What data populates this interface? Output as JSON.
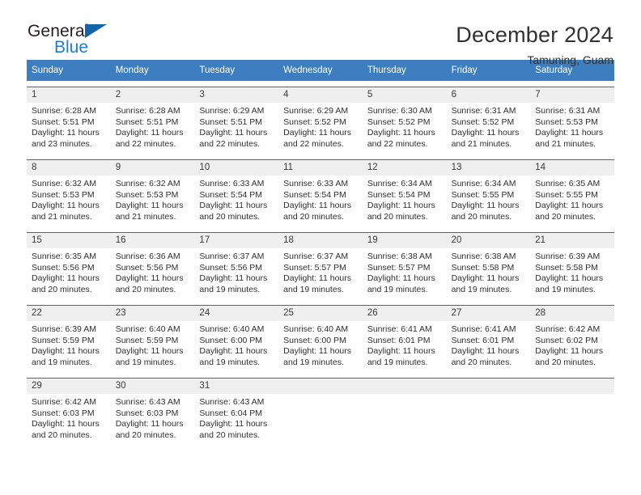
{
  "brand": {
    "name_top": "General",
    "name_bottom": "Blue",
    "triangle_color": "#1464aa",
    "blue_text_color": "#1b7fd4"
  },
  "header": {
    "title": "December 2024",
    "subtitle": "Tamuning, Guam"
  },
  "theme": {
    "header_row_bg": "#3c7ebf",
    "day_number_bg": "#efefef",
    "week_border": "#2f6ea8",
    "text": "#2e2e2e"
  },
  "weekdays": [
    "Sunday",
    "Monday",
    "Tuesday",
    "Wednesday",
    "Thursday",
    "Friday",
    "Saturday"
  ],
  "weeks": [
    [
      {
        "day": "1",
        "sunrise": "Sunrise: 6:28 AM",
        "sunset": "Sunset: 5:51 PM",
        "daylight1": "Daylight: 11 hours",
        "daylight2": "and 23 minutes."
      },
      {
        "day": "2",
        "sunrise": "Sunrise: 6:28 AM",
        "sunset": "Sunset: 5:51 PM",
        "daylight1": "Daylight: 11 hours",
        "daylight2": "and 22 minutes."
      },
      {
        "day": "3",
        "sunrise": "Sunrise: 6:29 AM",
        "sunset": "Sunset: 5:51 PM",
        "daylight1": "Daylight: 11 hours",
        "daylight2": "and 22 minutes."
      },
      {
        "day": "4",
        "sunrise": "Sunrise: 6:29 AM",
        "sunset": "Sunset: 5:52 PM",
        "daylight1": "Daylight: 11 hours",
        "daylight2": "and 22 minutes."
      },
      {
        "day": "5",
        "sunrise": "Sunrise: 6:30 AM",
        "sunset": "Sunset: 5:52 PM",
        "daylight1": "Daylight: 11 hours",
        "daylight2": "and 22 minutes."
      },
      {
        "day": "6",
        "sunrise": "Sunrise: 6:31 AM",
        "sunset": "Sunset: 5:52 PM",
        "daylight1": "Daylight: 11 hours",
        "daylight2": "and 21 minutes."
      },
      {
        "day": "7",
        "sunrise": "Sunrise: 6:31 AM",
        "sunset": "Sunset: 5:53 PM",
        "daylight1": "Daylight: 11 hours",
        "daylight2": "and 21 minutes."
      }
    ],
    [
      {
        "day": "8",
        "sunrise": "Sunrise: 6:32 AM",
        "sunset": "Sunset: 5:53 PM",
        "daylight1": "Daylight: 11 hours",
        "daylight2": "and 21 minutes."
      },
      {
        "day": "9",
        "sunrise": "Sunrise: 6:32 AM",
        "sunset": "Sunset: 5:53 PM",
        "daylight1": "Daylight: 11 hours",
        "daylight2": "and 21 minutes."
      },
      {
        "day": "10",
        "sunrise": "Sunrise: 6:33 AM",
        "sunset": "Sunset: 5:54 PM",
        "daylight1": "Daylight: 11 hours",
        "daylight2": "and 20 minutes."
      },
      {
        "day": "11",
        "sunrise": "Sunrise: 6:33 AM",
        "sunset": "Sunset: 5:54 PM",
        "daylight1": "Daylight: 11 hours",
        "daylight2": "and 20 minutes."
      },
      {
        "day": "12",
        "sunrise": "Sunrise: 6:34 AM",
        "sunset": "Sunset: 5:54 PM",
        "daylight1": "Daylight: 11 hours",
        "daylight2": "and 20 minutes."
      },
      {
        "day": "13",
        "sunrise": "Sunrise: 6:34 AM",
        "sunset": "Sunset: 5:55 PM",
        "daylight1": "Daylight: 11 hours",
        "daylight2": "and 20 minutes."
      },
      {
        "day": "14",
        "sunrise": "Sunrise: 6:35 AM",
        "sunset": "Sunset: 5:55 PM",
        "daylight1": "Daylight: 11 hours",
        "daylight2": "and 20 minutes."
      }
    ],
    [
      {
        "day": "15",
        "sunrise": "Sunrise: 6:35 AM",
        "sunset": "Sunset: 5:56 PM",
        "daylight1": "Daylight: 11 hours",
        "daylight2": "and 20 minutes."
      },
      {
        "day": "16",
        "sunrise": "Sunrise: 6:36 AM",
        "sunset": "Sunset: 5:56 PM",
        "daylight1": "Daylight: 11 hours",
        "daylight2": "and 20 minutes."
      },
      {
        "day": "17",
        "sunrise": "Sunrise: 6:37 AM",
        "sunset": "Sunset: 5:56 PM",
        "daylight1": "Daylight: 11 hours",
        "daylight2": "and 19 minutes."
      },
      {
        "day": "18",
        "sunrise": "Sunrise: 6:37 AM",
        "sunset": "Sunset: 5:57 PM",
        "daylight1": "Daylight: 11 hours",
        "daylight2": "and 19 minutes."
      },
      {
        "day": "19",
        "sunrise": "Sunrise: 6:38 AM",
        "sunset": "Sunset: 5:57 PM",
        "daylight1": "Daylight: 11 hours",
        "daylight2": "and 19 minutes."
      },
      {
        "day": "20",
        "sunrise": "Sunrise: 6:38 AM",
        "sunset": "Sunset: 5:58 PM",
        "daylight1": "Daylight: 11 hours",
        "daylight2": "and 19 minutes."
      },
      {
        "day": "21",
        "sunrise": "Sunrise: 6:39 AM",
        "sunset": "Sunset: 5:58 PM",
        "daylight1": "Daylight: 11 hours",
        "daylight2": "and 19 minutes."
      }
    ],
    [
      {
        "day": "22",
        "sunrise": "Sunrise: 6:39 AM",
        "sunset": "Sunset: 5:59 PM",
        "daylight1": "Daylight: 11 hours",
        "daylight2": "and 19 minutes."
      },
      {
        "day": "23",
        "sunrise": "Sunrise: 6:40 AM",
        "sunset": "Sunset: 5:59 PM",
        "daylight1": "Daylight: 11 hours",
        "daylight2": "and 19 minutes."
      },
      {
        "day": "24",
        "sunrise": "Sunrise: 6:40 AM",
        "sunset": "Sunset: 6:00 PM",
        "daylight1": "Daylight: 11 hours",
        "daylight2": "and 19 minutes."
      },
      {
        "day": "25",
        "sunrise": "Sunrise: 6:40 AM",
        "sunset": "Sunset: 6:00 PM",
        "daylight1": "Daylight: 11 hours",
        "daylight2": "and 19 minutes."
      },
      {
        "day": "26",
        "sunrise": "Sunrise: 6:41 AM",
        "sunset": "Sunset: 6:01 PM",
        "daylight1": "Daylight: 11 hours",
        "daylight2": "and 19 minutes."
      },
      {
        "day": "27",
        "sunrise": "Sunrise: 6:41 AM",
        "sunset": "Sunset: 6:01 PM",
        "daylight1": "Daylight: 11 hours",
        "daylight2": "and 20 minutes."
      },
      {
        "day": "28",
        "sunrise": "Sunrise: 6:42 AM",
        "sunset": "Sunset: 6:02 PM",
        "daylight1": "Daylight: 11 hours",
        "daylight2": "and 20 minutes."
      }
    ],
    [
      {
        "day": "29",
        "sunrise": "Sunrise: 6:42 AM",
        "sunset": "Sunset: 6:03 PM",
        "daylight1": "Daylight: 11 hours",
        "daylight2": "and 20 minutes."
      },
      {
        "day": "30",
        "sunrise": "Sunrise: 6:43 AM",
        "sunset": "Sunset: 6:03 PM",
        "daylight1": "Daylight: 11 hours",
        "daylight2": "and 20 minutes."
      },
      {
        "day": "31",
        "sunrise": "Sunrise: 6:43 AM",
        "sunset": "Sunset: 6:04 PM",
        "daylight1": "Daylight: 11 hours",
        "daylight2": "and 20 minutes."
      },
      {
        "day": "",
        "sunrise": "",
        "sunset": "",
        "daylight1": "",
        "daylight2": ""
      },
      {
        "day": "",
        "sunrise": "",
        "sunset": "",
        "daylight1": "",
        "daylight2": ""
      },
      {
        "day": "",
        "sunrise": "",
        "sunset": "",
        "daylight1": "",
        "daylight2": ""
      },
      {
        "day": "",
        "sunrise": "",
        "sunset": "",
        "daylight1": "",
        "daylight2": ""
      }
    ]
  ]
}
